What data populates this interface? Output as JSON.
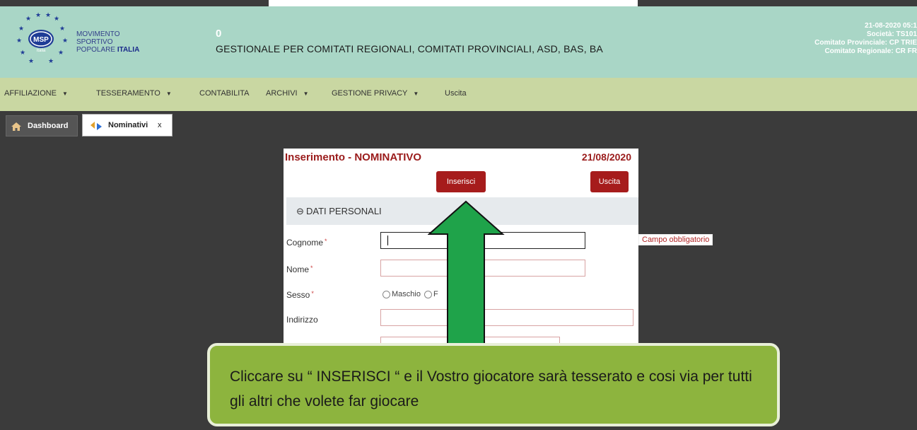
{
  "header": {
    "logo_abbr": "MSP",
    "logo_sub": "Italia",
    "logo_lines": [
      "MOVIMENTO",
      "SPORTIVO"
    ],
    "logo_line3_prefix": "POPOLARE",
    "logo_line3_suffix": "ITALIA",
    "zero": "0",
    "title": "GESTIONALE PER COMITATI REGIONALI, COMITATI PROVINCIALI, ASD, BAS, BA",
    "right_lines": [
      "21-08-2020 05:1",
      "Società: TS101",
      "Comitato Provinciale: CP TRIE",
      "Comitato Regionale: CR FR"
    ]
  },
  "menu": {
    "items": [
      {
        "label": "AFFILIAZIONE",
        "caret": true
      },
      {
        "label": "TESSERAMENTO",
        "caret": true
      },
      {
        "label": "CONTABILITA",
        "caret": false
      },
      {
        "label": "ARCHIVI",
        "caret": true
      },
      {
        "label": "GESTIONE PRIVACY",
        "caret": true
      },
      {
        "label": "Uscita",
        "caret": false
      }
    ]
  },
  "tabs": {
    "dashboard": "Dashboard",
    "nominativi": "Nominativi",
    "close": "x"
  },
  "form": {
    "title": "Inserimento - NOMINATIVO",
    "date": "21/08/2020",
    "inserisci": "Inserisci",
    "uscita": "Uscita",
    "section": "DATI PERSONALI",
    "cognome": "Cognome",
    "nome": "Nome",
    "sesso": "Sesso",
    "maschio": "Maschio",
    "femmina": "F",
    "indirizzo": "Indirizzo",
    "required_mark": "*",
    "error": "Campo obbligatorio"
  },
  "callout": {
    "text": "Cliccare su “ INSERISCI “ e il Vostro giocatore sarà tesserato e cosi via per tutti gli altri che volete far giocare"
  },
  "colors": {
    "header_bg": "#a9d6c6",
    "menu_bg": "#c9d7a2",
    "accent_red": "#a61c1c",
    "arrow_green": "#1fa34a",
    "callout_green": "#8db43e"
  }
}
